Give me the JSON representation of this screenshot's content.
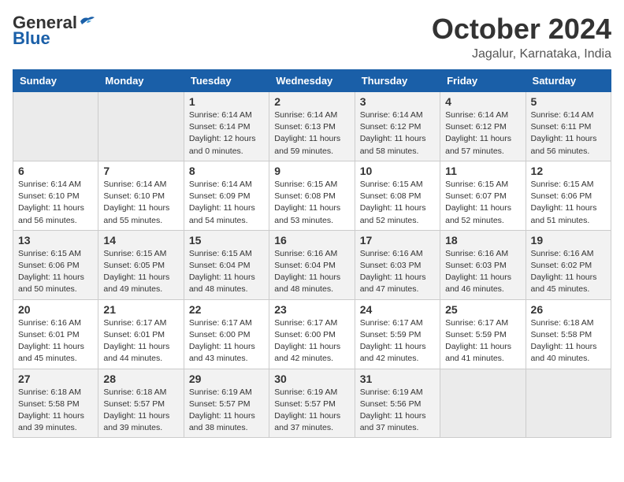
{
  "header": {
    "logo_general": "General",
    "logo_blue": "Blue",
    "month": "October 2024",
    "location": "Jagalur, Karnataka, India"
  },
  "weekdays": [
    "Sunday",
    "Monday",
    "Tuesday",
    "Wednesday",
    "Thursday",
    "Friday",
    "Saturday"
  ],
  "weeks": [
    [
      {
        "day": "",
        "info": ""
      },
      {
        "day": "",
        "info": ""
      },
      {
        "day": "1",
        "info": "Sunrise: 6:14 AM\nSunset: 6:14 PM\nDaylight: 12 hours\nand 0 minutes."
      },
      {
        "day": "2",
        "info": "Sunrise: 6:14 AM\nSunset: 6:13 PM\nDaylight: 11 hours\nand 59 minutes."
      },
      {
        "day": "3",
        "info": "Sunrise: 6:14 AM\nSunset: 6:12 PM\nDaylight: 11 hours\nand 58 minutes."
      },
      {
        "day": "4",
        "info": "Sunrise: 6:14 AM\nSunset: 6:12 PM\nDaylight: 11 hours\nand 57 minutes."
      },
      {
        "day": "5",
        "info": "Sunrise: 6:14 AM\nSunset: 6:11 PM\nDaylight: 11 hours\nand 56 minutes."
      }
    ],
    [
      {
        "day": "6",
        "info": "Sunrise: 6:14 AM\nSunset: 6:10 PM\nDaylight: 11 hours\nand 56 minutes."
      },
      {
        "day": "7",
        "info": "Sunrise: 6:14 AM\nSunset: 6:10 PM\nDaylight: 11 hours\nand 55 minutes."
      },
      {
        "day": "8",
        "info": "Sunrise: 6:14 AM\nSunset: 6:09 PM\nDaylight: 11 hours\nand 54 minutes."
      },
      {
        "day": "9",
        "info": "Sunrise: 6:15 AM\nSunset: 6:08 PM\nDaylight: 11 hours\nand 53 minutes."
      },
      {
        "day": "10",
        "info": "Sunrise: 6:15 AM\nSunset: 6:08 PM\nDaylight: 11 hours\nand 52 minutes."
      },
      {
        "day": "11",
        "info": "Sunrise: 6:15 AM\nSunset: 6:07 PM\nDaylight: 11 hours\nand 52 minutes."
      },
      {
        "day": "12",
        "info": "Sunrise: 6:15 AM\nSunset: 6:06 PM\nDaylight: 11 hours\nand 51 minutes."
      }
    ],
    [
      {
        "day": "13",
        "info": "Sunrise: 6:15 AM\nSunset: 6:06 PM\nDaylight: 11 hours\nand 50 minutes."
      },
      {
        "day": "14",
        "info": "Sunrise: 6:15 AM\nSunset: 6:05 PM\nDaylight: 11 hours\nand 49 minutes."
      },
      {
        "day": "15",
        "info": "Sunrise: 6:15 AM\nSunset: 6:04 PM\nDaylight: 11 hours\nand 48 minutes."
      },
      {
        "day": "16",
        "info": "Sunrise: 6:16 AM\nSunset: 6:04 PM\nDaylight: 11 hours\nand 48 minutes."
      },
      {
        "day": "17",
        "info": "Sunrise: 6:16 AM\nSunset: 6:03 PM\nDaylight: 11 hours\nand 47 minutes."
      },
      {
        "day": "18",
        "info": "Sunrise: 6:16 AM\nSunset: 6:03 PM\nDaylight: 11 hours\nand 46 minutes."
      },
      {
        "day": "19",
        "info": "Sunrise: 6:16 AM\nSunset: 6:02 PM\nDaylight: 11 hours\nand 45 minutes."
      }
    ],
    [
      {
        "day": "20",
        "info": "Sunrise: 6:16 AM\nSunset: 6:01 PM\nDaylight: 11 hours\nand 45 minutes."
      },
      {
        "day": "21",
        "info": "Sunrise: 6:17 AM\nSunset: 6:01 PM\nDaylight: 11 hours\nand 44 minutes."
      },
      {
        "day": "22",
        "info": "Sunrise: 6:17 AM\nSunset: 6:00 PM\nDaylight: 11 hours\nand 43 minutes."
      },
      {
        "day": "23",
        "info": "Sunrise: 6:17 AM\nSunset: 6:00 PM\nDaylight: 11 hours\nand 42 minutes."
      },
      {
        "day": "24",
        "info": "Sunrise: 6:17 AM\nSunset: 5:59 PM\nDaylight: 11 hours\nand 42 minutes."
      },
      {
        "day": "25",
        "info": "Sunrise: 6:17 AM\nSunset: 5:59 PM\nDaylight: 11 hours\nand 41 minutes."
      },
      {
        "day": "26",
        "info": "Sunrise: 6:18 AM\nSunset: 5:58 PM\nDaylight: 11 hours\nand 40 minutes."
      }
    ],
    [
      {
        "day": "27",
        "info": "Sunrise: 6:18 AM\nSunset: 5:58 PM\nDaylight: 11 hours\nand 39 minutes."
      },
      {
        "day": "28",
        "info": "Sunrise: 6:18 AM\nSunset: 5:57 PM\nDaylight: 11 hours\nand 39 minutes."
      },
      {
        "day": "29",
        "info": "Sunrise: 6:19 AM\nSunset: 5:57 PM\nDaylight: 11 hours\nand 38 minutes."
      },
      {
        "day": "30",
        "info": "Sunrise: 6:19 AM\nSunset: 5:57 PM\nDaylight: 11 hours\nand 37 minutes."
      },
      {
        "day": "31",
        "info": "Sunrise: 6:19 AM\nSunset: 5:56 PM\nDaylight: 11 hours\nand 37 minutes."
      },
      {
        "day": "",
        "info": ""
      },
      {
        "day": "",
        "info": ""
      }
    ]
  ]
}
